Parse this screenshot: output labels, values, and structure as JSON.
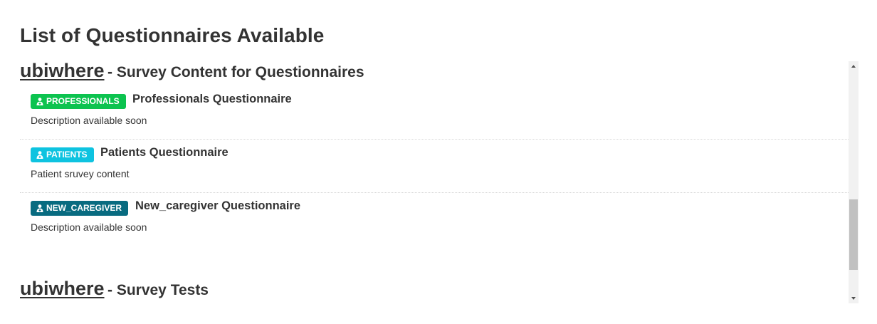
{
  "page": {
    "title": "List of Questionnaires Available"
  },
  "surveys": [
    {
      "org": "ubiwhere",
      "separator": "-",
      "title": "Survey Content for Questionnaires",
      "questionnaires": [
        {
          "badge": "PROFESSIONALS",
          "badge_color": "#0cc34f",
          "badge_icon": "user-md-icon",
          "title": "Professionals Questionnaire",
          "description": "Description available soon"
        },
        {
          "badge": "PATIENTS",
          "badge_color": "#0ec3e0",
          "badge_icon": "user-md-icon",
          "title": "Patients Questionnaire",
          "description": "Patient sruvey content"
        },
        {
          "badge": "NEW_CAREGIVER",
          "badge_color": "#086b80",
          "badge_icon": "user-md-icon",
          "title": "New_caregiver Questionnaire",
          "description": "Description available soon"
        }
      ]
    },
    {
      "org": "ubiwhere",
      "separator": "-",
      "title": "Survey Tests",
      "questionnaires": []
    }
  ],
  "scrollbar": {
    "up_icon": "arrow-up-icon",
    "down_icon": "arrow-down-icon"
  }
}
